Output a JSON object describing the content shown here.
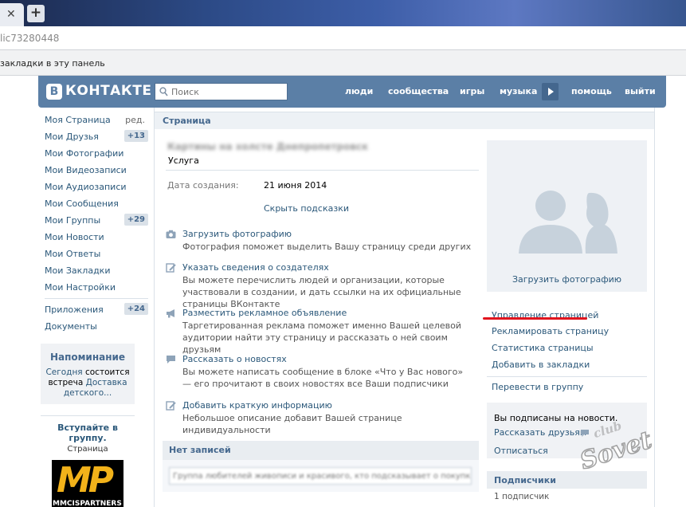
{
  "browser": {
    "url": "lic73280448",
    "bookmarks_hint": "закладки в эту панель"
  },
  "header": {
    "logo_letter": "В",
    "logo_text": "КОНТАКТЕ",
    "search_placeholder": "Поиск",
    "nav": [
      "люди",
      "сообщества",
      "игры",
      "музыка",
      "помощь",
      "выйти"
    ]
  },
  "menu": {
    "items": [
      {
        "label": "Моя Страница",
        "extra": "ред."
      },
      {
        "label": "Мои Друзья",
        "badge": "+13"
      },
      {
        "label": "Мои Фотографии"
      },
      {
        "label": "Мои Видеозаписи"
      },
      {
        "label": "Мои Аудиозаписи"
      },
      {
        "label": "Мои Сообщения"
      },
      {
        "label": "Мои Группы",
        "badge": "+29"
      },
      {
        "label": "Мои Новости"
      },
      {
        "label": "Мои Ответы"
      },
      {
        "label": "Мои Закладки"
      },
      {
        "label": "Мои Настройки"
      }
    ],
    "extra_items": [
      {
        "label": "Приложения",
        "badge": "+24"
      },
      {
        "label": "Документы"
      }
    ]
  },
  "reminder": {
    "title": "Напоминание",
    "today": "Сегодня",
    "text": "состоится встреча",
    "link": "Доставка детского..."
  },
  "join": {
    "title": "Вступайте в группу.",
    "sub": "Страница",
    "logo_text": "MP",
    "logo_sub": "MMCISPARTNERS"
  },
  "page": {
    "section_title": "Страница",
    "name": "Картины на холсте Днепропетровск",
    "category": "Услуга",
    "created_label": "Дата создания:",
    "created_value": "21 июня 2014",
    "hide_hints": "Скрыть подсказки",
    "tips": [
      {
        "icon": "camera-icon",
        "title": "Загрузить фотографию",
        "desc": "Фотография поможет выделить Вашу страницу среди других"
      },
      {
        "icon": "pencil-icon",
        "title": "Указать сведения о создателях",
        "desc": "Вы можете перечислить людей и организации, которые участвовали в создании, и дать ссылки на их официальные страницы ВКонтакте"
      },
      {
        "icon": "megaphone-icon",
        "title": "Разместить рекламное объявление",
        "desc": "Таргетированная реклама поможет именно Вашей целевой аудитории найти эту страницу и рассказать о ней своим друзьям"
      },
      {
        "icon": "chat-bubble-icon",
        "title": "Рассказать о новостях",
        "desc": "Вы можете написать сообщение в блоке «Что у Вас нового» — его прочитают в своих новостях все Ваши подписчики"
      },
      {
        "icon": "pencil-icon",
        "title": "Добавить краткую информацию",
        "desc": "Небольшое описание добавит Вашей странице индивидуальности"
      }
    ],
    "no_posts": "Нет записей",
    "wall_placeholder": "Группа любителей живописи и красивого, кто подсказывает о покупке"
  },
  "right": {
    "upload_photo": "Загрузить фотографию",
    "links": [
      "Управление страницей",
      "Рекламировать страницу",
      "Статистика страницы",
      "Добавить в закладки"
    ],
    "move_to_group": "Перевести в группу",
    "subscribed": "Вы подписаны на новости.",
    "tell_friends": "Рассказать друзьям",
    "unsubscribe": "Отписаться",
    "subscribers_title": "Подписчики",
    "subscribers_count": "1 подписчик"
  },
  "watermark": {
    "top": "club",
    "main": "Sovet"
  },
  "colors": {
    "header": "#5b7fa6",
    "link": "#2b587a",
    "highlight": "#e1141e"
  }
}
